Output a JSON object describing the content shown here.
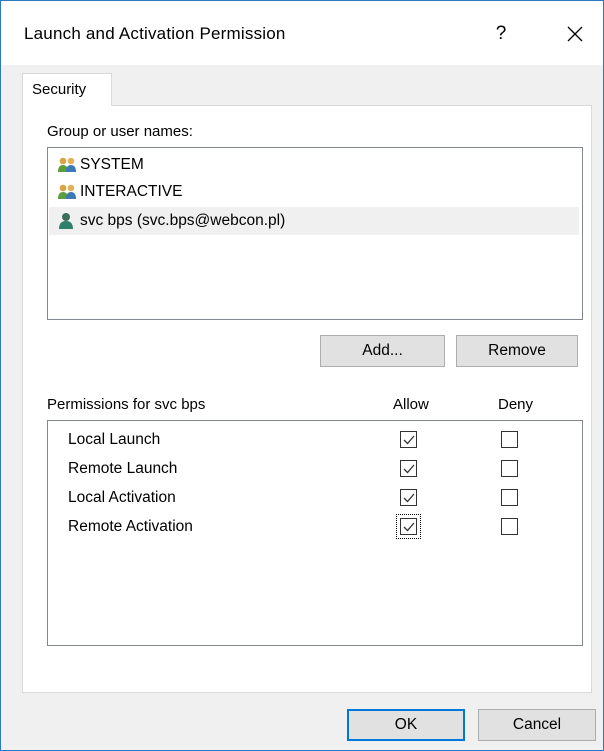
{
  "window": {
    "title": "Launch and Activation Permission",
    "help_label": "?",
    "accent_color": "#0078d7"
  },
  "tabs": [
    {
      "label": "Security",
      "selected": true
    }
  ],
  "users": {
    "label": "Group or user names:",
    "items": [
      {
        "name": "SYSTEM",
        "icon": "group-users-icon",
        "selected": false
      },
      {
        "name": "INTERACTIVE",
        "icon": "group-users-icon",
        "selected": false
      },
      {
        "name": "svc bps (svc.bps@webcon.pl)",
        "icon": "user-icon",
        "selected": true
      }
    ]
  },
  "buttons": {
    "add": "Add...",
    "remove": "Remove",
    "ok": "OK",
    "cancel": "Cancel"
  },
  "permissions": {
    "label": "Permissions for svc bps",
    "allow_header": "Allow",
    "deny_header": "Deny",
    "rows": [
      {
        "name": "Local Launch",
        "allow": true,
        "deny": false
      },
      {
        "name": "Remote Launch",
        "allow": true,
        "deny": false
      },
      {
        "name": "Local Activation",
        "allow": true,
        "deny": false
      },
      {
        "name": "Remote Activation",
        "allow": true,
        "deny": false,
        "focused": true
      }
    ]
  }
}
